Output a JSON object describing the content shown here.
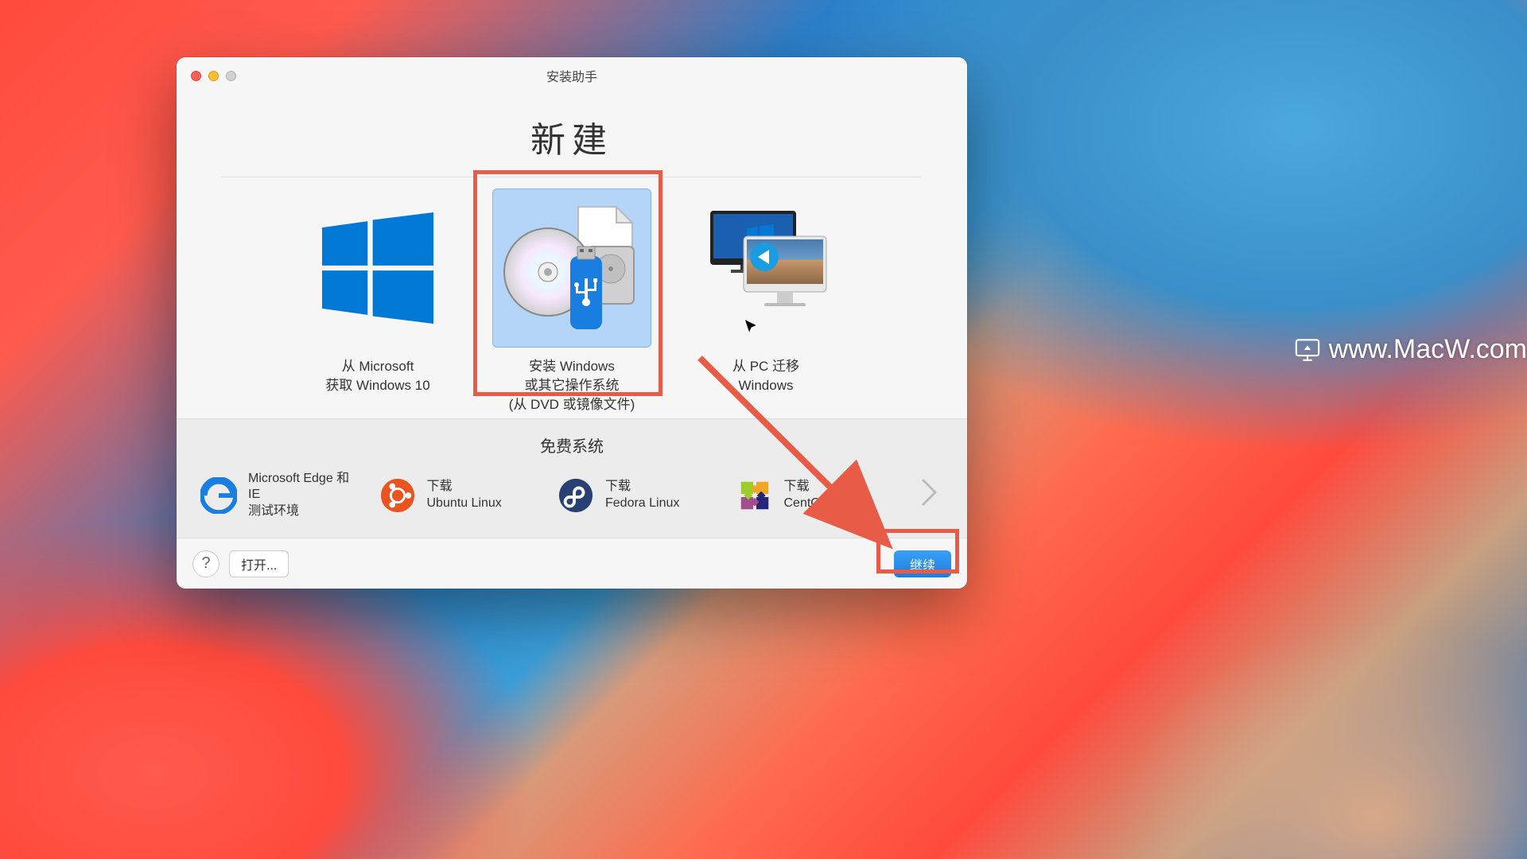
{
  "window": {
    "title": "安装助手",
    "heading": "新建"
  },
  "options": [
    {
      "line1": "从 Microsoft",
      "line2": "获取 Windows 10",
      "selected": false
    },
    {
      "line1": "安装 Windows",
      "line2": "或其它操作系统",
      "line3": "(从 DVD 或镜像文件)",
      "selected": true
    },
    {
      "line1": "从 PC 迁移",
      "line2": "Windows",
      "selected": false
    }
  ],
  "free_section": {
    "title": "免费系统",
    "items": [
      {
        "line1": "Microsoft Edge 和 IE",
        "line2": "测试环境",
        "icon": "edge"
      },
      {
        "line1": "下载",
        "line2": "Ubuntu Linux",
        "icon": "ubuntu"
      },
      {
        "line1": "下载",
        "line2": "Fedora Linux",
        "icon": "fedora"
      },
      {
        "line1": "下载",
        "line2": "CentOS Linux",
        "icon": "centos"
      }
    ]
  },
  "footer": {
    "help_label": "?",
    "open_label": "打开...",
    "continue_label": "继续"
  },
  "watermark": "www.MacW.com"
}
